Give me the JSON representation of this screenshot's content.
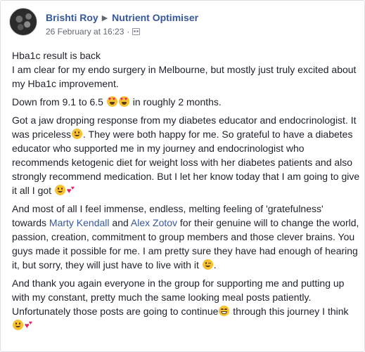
{
  "post": {
    "author": "Brishti Roy",
    "group": "Nutrient Optimiser",
    "date": "26 February at 16:23",
    "audience_icon": "group-audience-icon",
    "paragraphs": {
      "p1_line1": "Hba1c result is back",
      "p1_line2": "I am clear for my endo surgery in Melbourne, but mostly just truly excited about my Hba1c improvement.",
      "p2_text": "Down from 9.1 to 6.5 ",
      "p2_tail": " in roughly 2 months.",
      "p3_a": "Got a jaw dropping response from my diabetes educator and endocrinologist. It was priceless",
      "p3_b": ". They were both happy for me. So grateful to have a diabetes educator who supported me in my journey and endocrinologist who recommends ketogenic diet for weight loss with her diabetes patients and also strongly recommend medication. But I let her know today that I am going to give it all I got ",
      "p4_a": "And most of all I feel immense, endless, melting feeling of 'gratefulness' towards ",
      "mention1": "Marty Kendall",
      "p4_and": " and ",
      "mention2": "Alex Zotov",
      "p4_b": " for their genuine will to change the world, passion, creation, commitment to group members and those clever brains. You guys made it possible for me. I am pretty sure they have had enough of hearing it, but sorry, they will just have to live with it ",
      "p4_end": ".",
      "p5_a": "And thank you again everyone in the group for supporting me and putting up with my constant, pretty much the same looking meal posts patiently. Unfortunately those posts are going to continue",
      "p5_b": " through this journey I think"
    }
  },
  "colors": {
    "link": "#365899",
    "text": "#1d2129",
    "meta": "#616770",
    "emoji_face": "#f7c232",
    "heart": "#e0245e"
  },
  "icons": [
    "group-audience-icon",
    "heart-eyes-emoji-icon",
    "smile-emoji-icon",
    "two-hearts-emoji-icon",
    "wink-emoji-icon",
    "smiling-eyes-emoji-icon"
  ]
}
